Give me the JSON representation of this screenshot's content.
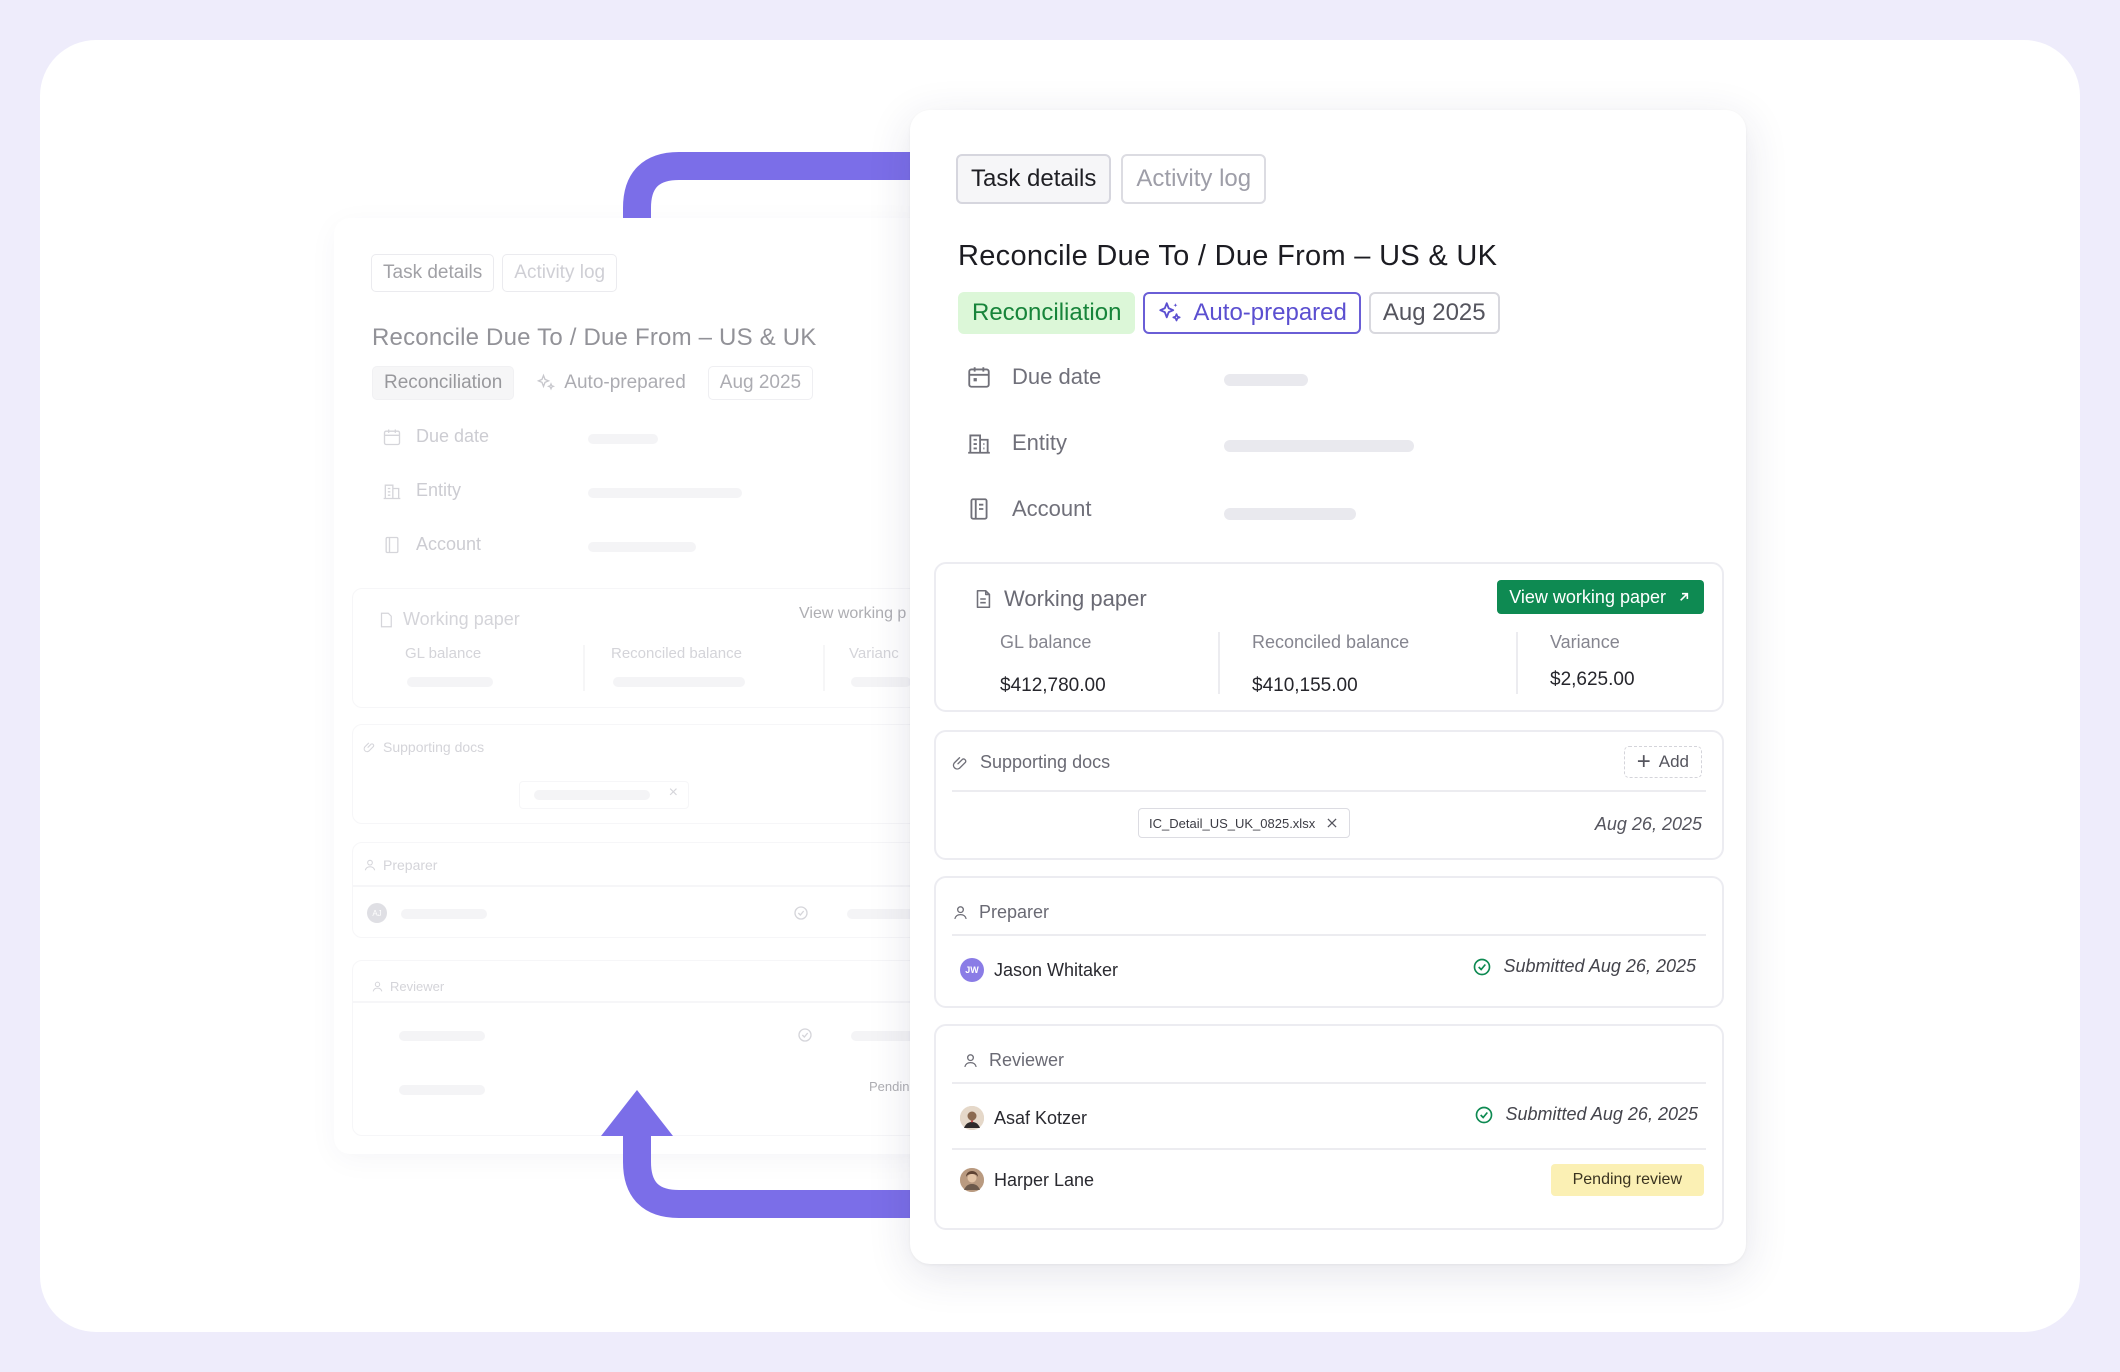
{
  "colors": {
    "accent": "#7b6ee8",
    "green": "#0e8a52",
    "reconciliation_bg": "#dcf7d8",
    "reconciliation_fg": "#17843a",
    "auto_prepared": "#5b4fd0",
    "pending_bg": "#fbf0b4"
  },
  "background_card": {
    "tabs": [
      {
        "label": "Task details"
      },
      {
        "label": "Activity log"
      }
    ],
    "title": "Reconcile Due To / Due From – US & UK",
    "chips": {
      "type": "Reconciliation",
      "auto": "Auto-prepared",
      "period": "Aug 2025"
    },
    "fields": [
      {
        "label": "Due date"
      },
      {
        "label": "Entity"
      },
      {
        "label": "Account"
      }
    ],
    "working_paper": {
      "title": "Working paper",
      "view_button": "View working p",
      "gl_label": "GL balance",
      "reconciled_label": "Reconciled balance",
      "variance_label": "Varianc"
    },
    "supporting_docs": {
      "title": "Supporting docs"
    },
    "preparer": {
      "title": "Preparer",
      "initials": "AJ"
    },
    "reviewer": {
      "title": "Reviewer",
      "pending": "Pendin"
    }
  },
  "card": {
    "tabs": [
      {
        "label": "Task details",
        "active": true
      },
      {
        "label": "Activity log",
        "active": false
      }
    ],
    "title": "Reconcile Due To / Due From – US & UK",
    "chips": {
      "type": "Reconciliation",
      "auto": "Auto-prepared",
      "period": "Aug 2025"
    },
    "fields": [
      {
        "label": "Due date",
        "icon": "calendar-icon"
      },
      {
        "label": "Entity",
        "icon": "building-icon"
      },
      {
        "label": "Account",
        "icon": "ledger-icon"
      }
    ],
    "working_paper": {
      "title": "Working paper",
      "view_button": "View working paper",
      "metrics": [
        {
          "label": "GL balance",
          "value": "$412,780.00"
        },
        {
          "label": "Reconciled balance",
          "value": "$410,155.00"
        },
        {
          "label": "Variance",
          "value": "$2,625.00"
        }
      ]
    },
    "supporting_docs": {
      "title": "Supporting docs",
      "add_label": "Add",
      "file_name": "IC_Detail_US_UK_0825.xlsx",
      "file_date": "Aug 26, 2025"
    },
    "preparer": {
      "title": "Preparer",
      "name": "Jason Whitaker",
      "initials": "JW",
      "status": "Submitted Aug 26, 2025"
    },
    "reviewer": {
      "title": "Reviewer",
      "people": [
        {
          "name": "Asaf Kotzer",
          "status": "Submitted Aug 26, 2025"
        },
        {
          "name": "Harper Lane",
          "status": "Pending review"
        }
      ]
    }
  }
}
